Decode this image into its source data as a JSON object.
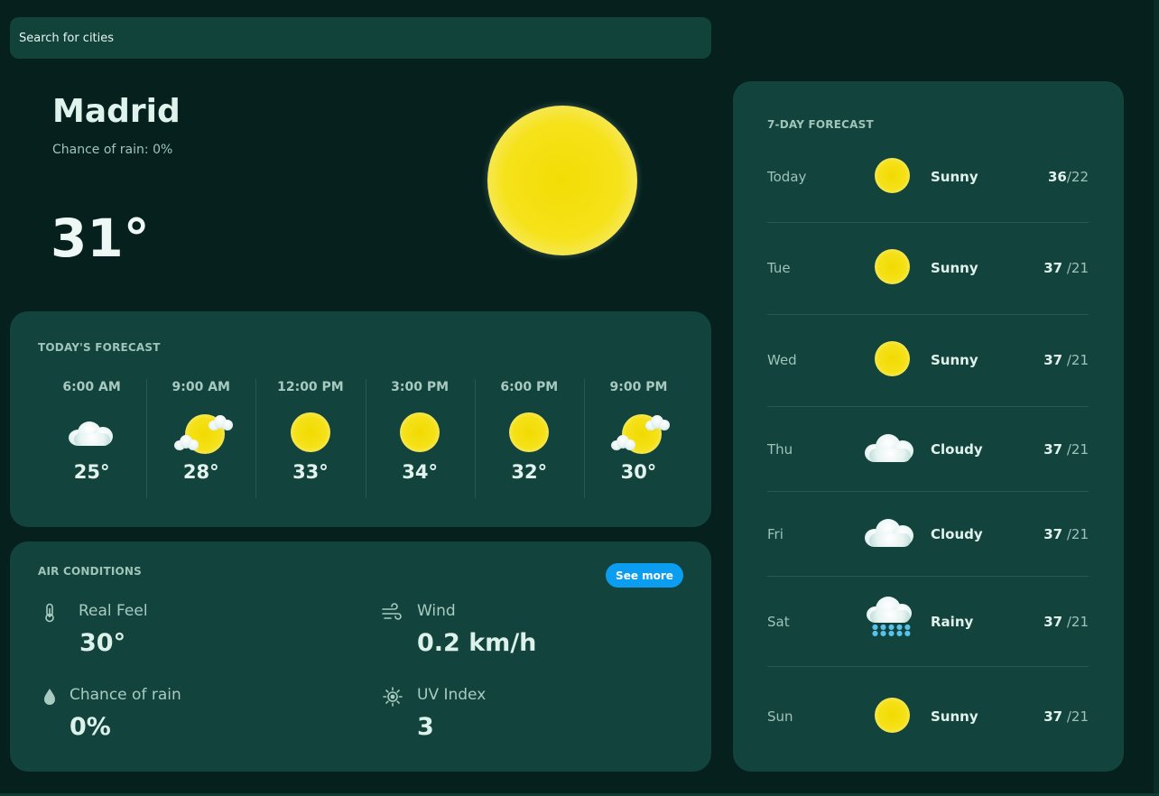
{
  "search": {
    "placeholder": "Search for cities"
  },
  "current": {
    "city": "Madrid",
    "rain_chance": "Chance of rain: 0%",
    "temperature": "31°",
    "icon": "sun-icon"
  },
  "today_forecast": {
    "title": "TODAY'S FORECAST",
    "hours": [
      {
        "time": "6:00 AM",
        "icon": "cloud-icon",
        "temp": "25°"
      },
      {
        "time": "9:00 AM",
        "icon": "partly-cloudy-icon",
        "temp": "28°"
      },
      {
        "time": "12:00 PM",
        "icon": "sun-icon",
        "temp": "33°"
      },
      {
        "time": "3:00 PM",
        "icon": "sun-icon",
        "temp": "34°"
      },
      {
        "time": "6:00 PM",
        "icon": "sun-icon",
        "temp": "32°"
      },
      {
        "time": "9:00 PM",
        "icon": "partly-cloudy-icon",
        "temp": "30°"
      }
    ]
  },
  "air_conditions": {
    "title": "AIR CONDITIONS",
    "see_more": "See more",
    "items": [
      {
        "label": "Real Feel",
        "value": "30°",
        "icon": "thermometer-icon"
      },
      {
        "label": "Wind",
        "value": "0.2 km/h",
        "icon": "wind-icon"
      },
      {
        "label": "Chance of rain",
        "value": "0%",
        "icon": "droplet-icon"
      },
      {
        "label": "UV Index",
        "value": "3",
        "icon": "uv-sun-icon"
      }
    ]
  },
  "week_forecast": {
    "title": "7-DAY FORECAST",
    "days": [
      {
        "day": "Today",
        "icon": "sun-icon",
        "condition": "Sunny",
        "high": "36",
        "low": "/22"
      },
      {
        "day": "Tue",
        "icon": "sun-icon",
        "condition": "Sunny",
        "high": "37",
        "low": " /21"
      },
      {
        "day": "Wed",
        "icon": "sun-icon",
        "condition": "Sunny",
        "high": "37",
        "low": " /21"
      },
      {
        "day": "Thu",
        "icon": "cloud-icon",
        "condition": "Cloudy",
        "high": "37",
        "low": " /21"
      },
      {
        "day": "Fri",
        "icon": "cloud-icon",
        "condition": "Cloudy",
        "high": "37",
        "low": " /21"
      },
      {
        "day": "Sat",
        "icon": "rain-cloud-icon",
        "condition": "Rainy",
        "high": "37",
        "low": " /21"
      },
      {
        "day": "Sun",
        "icon": "sun-icon",
        "condition": "Sunny",
        "high": "37",
        "low": " /21"
      }
    ]
  },
  "colors": {
    "background": "#05201d",
    "card": "#12433c",
    "accent_button": "#0b9df0",
    "sun_yellow": "#f1da02",
    "muted_text": "#9fc4ba"
  }
}
